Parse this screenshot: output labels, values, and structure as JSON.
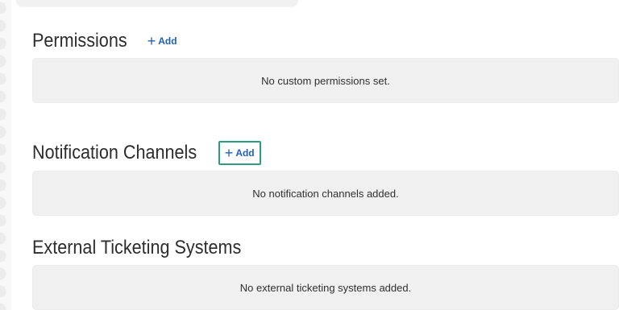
{
  "sections": [
    {
      "title": "Permissions",
      "add_label": "Add",
      "add_icon": "plus-icon",
      "empty_text": "No custom permissions set."
    },
    {
      "title": "Notification Channels",
      "add_label": "Add",
      "add_icon": "plus-icon",
      "empty_text": "No notification channels added."
    },
    {
      "title": "External Ticketing Systems",
      "empty_text": "No external ticketing systems added."
    }
  ],
  "colors": {
    "accent": "#1f5fb8",
    "focus_ring": "#2a9d7f",
    "empty_box": "#f0f0f0"
  }
}
